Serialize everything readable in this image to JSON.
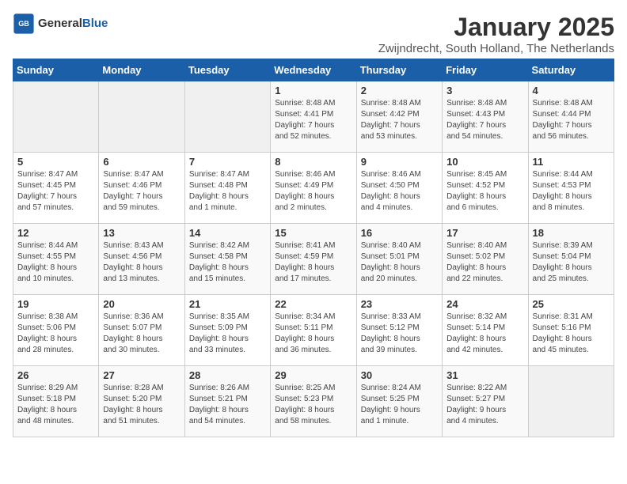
{
  "logo": {
    "general": "General",
    "blue": "Blue"
  },
  "title": "January 2025",
  "subtitle": "Zwijndrecht, South Holland, The Netherlands",
  "days_of_week": [
    "Sunday",
    "Monday",
    "Tuesday",
    "Wednesday",
    "Thursday",
    "Friday",
    "Saturday"
  ],
  "weeks": [
    [
      {
        "day": "",
        "info": ""
      },
      {
        "day": "",
        "info": ""
      },
      {
        "day": "",
        "info": ""
      },
      {
        "day": "1",
        "info": "Sunrise: 8:48 AM\nSunset: 4:41 PM\nDaylight: 7 hours\nand 52 minutes."
      },
      {
        "day": "2",
        "info": "Sunrise: 8:48 AM\nSunset: 4:42 PM\nDaylight: 7 hours\nand 53 minutes."
      },
      {
        "day": "3",
        "info": "Sunrise: 8:48 AM\nSunset: 4:43 PM\nDaylight: 7 hours\nand 54 minutes."
      },
      {
        "day": "4",
        "info": "Sunrise: 8:48 AM\nSunset: 4:44 PM\nDaylight: 7 hours\nand 56 minutes."
      }
    ],
    [
      {
        "day": "5",
        "info": "Sunrise: 8:47 AM\nSunset: 4:45 PM\nDaylight: 7 hours\nand 57 minutes."
      },
      {
        "day": "6",
        "info": "Sunrise: 8:47 AM\nSunset: 4:46 PM\nDaylight: 7 hours\nand 59 minutes."
      },
      {
        "day": "7",
        "info": "Sunrise: 8:47 AM\nSunset: 4:48 PM\nDaylight: 8 hours\nand 1 minute."
      },
      {
        "day": "8",
        "info": "Sunrise: 8:46 AM\nSunset: 4:49 PM\nDaylight: 8 hours\nand 2 minutes."
      },
      {
        "day": "9",
        "info": "Sunrise: 8:46 AM\nSunset: 4:50 PM\nDaylight: 8 hours\nand 4 minutes."
      },
      {
        "day": "10",
        "info": "Sunrise: 8:45 AM\nSunset: 4:52 PM\nDaylight: 8 hours\nand 6 minutes."
      },
      {
        "day": "11",
        "info": "Sunrise: 8:44 AM\nSunset: 4:53 PM\nDaylight: 8 hours\nand 8 minutes."
      }
    ],
    [
      {
        "day": "12",
        "info": "Sunrise: 8:44 AM\nSunset: 4:55 PM\nDaylight: 8 hours\nand 10 minutes."
      },
      {
        "day": "13",
        "info": "Sunrise: 8:43 AM\nSunset: 4:56 PM\nDaylight: 8 hours\nand 13 minutes."
      },
      {
        "day": "14",
        "info": "Sunrise: 8:42 AM\nSunset: 4:58 PM\nDaylight: 8 hours\nand 15 minutes."
      },
      {
        "day": "15",
        "info": "Sunrise: 8:41 AM\nSunset: 4:59 PM\nDaylight: 8 hours\nand 17 minutes."
      },
      {
        "day": "16",
        "info": "Sunrise: 8:40 AM\nSunset: 5:01 PM\nDaylight: 8 hours\nand 20 minutes."
      },
      {
        "day": "17",
        "info": "Sunrise: 8:40 AM\nSunset: 5:02 PM\nDaylight: 8 hours\nand 22 minutes."
      },
      {
        "day": "18",
        "info": "Sunrise: 8:39 AM\nSunset: 5:04 PM\nDaylight: 8 hours\nand 25 minutes."
      }
    ],
    [
      {
        "day": "19",
        "info": "Sunrise: 8:38 AM\nSunset: 5:06 PM\nDaylight: 8 hours\nand 28 minutes."
      },
      {
        "day": "20",
        "info": "Sunrise: 8:36 AM\nSunset: 5:07 PM\nDaylight: 8 hours\nand 30 minutes."
      },
      {
        "day": "21",
        "info": "Sunrise: 8:35 AM\nSunset: 5:09 PM\nDaylight: 8 hours\nand 33 minutes."
      },
      {
        "day": "22",
        "info": "Sunrise: 8:34 AM\nSunset: 5:11 PM\nDaylight: 8 hours\nand 36 minutes."
      },
      {
        "day": "23",
        "info": "Sunrise: 8:33 AM\nSunset: 5:12 PM\nDaylight: 8 hours\nand 39 minutes."
      },
      {
        "day": "24",
        "info": "Sunrise: 8:32 AM\nSunset: 5:14 PM\nDaylight: 8 hours\nand 42 minutes."
      },
      {
        "day": "25",
        "info": "Sunrise: 8:31 AM\nSunset: 5:16 PM\nDaylight: 8 hours\nand 45 minutes."
      }
    ],
    [
      {
        "day": "26",
        "info": "Sunrise: 8:29 AM\nSunset: 5:18 PM\nDaylight: 8 hours\nand 48 minutes."
      },
      {
        "day": "27",
        "info": "Sunrise: 8:28 AM\nSunset: 5:20 PM\nDaylight: 8 hours\nand 51 minutes."
      },
      {
        "day": "28",
        "info": "Sunrise: 8:26 AM\nSunset: 5:21 PM\nDaylight: 8 hours\nand 54 minutes."
      },
      {
        "day": "29",
        "info": "Sunrise: 8:25 AM\nSunset: 5:23 PM\nDaylight: 8 hours\nand 58 minutes."
      },
      {
        "day": "30",
        "info": "Sunrise: 8:24 AM\nSunset: 5:25 PM\nDaylight: 9 hours\nand 1 minute."
      },
      {
        "day": "31",
        "info": "Sunrise: 8:22 AM\nSunset: 5:27 PM\nDaylight: 9 hours\nand 4 minutes."
      },
      {
        "day": "",
        "info": ""
      }
    ]
  ]
}
